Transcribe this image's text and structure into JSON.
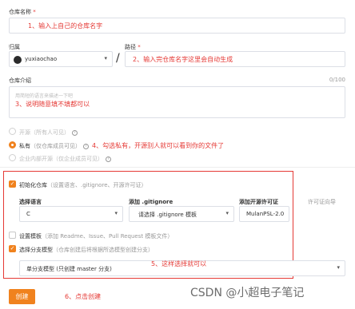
{
  "repo_name": {
    "label": "仓库名称",
    "required_mark": "*",
    "note": "1、输入上自己的仓库名字"
  },
  "owner": {
    "label": "归属",
    "value": "yuxiaochao"
  },
  "path": {
    "label": "路径",
    "required_mark": "*",
    "separator": "/",
    "note": "2、输入完仓库名字这里会自动生成"
  },
  "intro": {
    "label": "仓库介绍",
    "counter": "0/100",
    "placeholder": "用简短的语言来描述一下吧",
    "note": "3、说明随意填不填都可以"
  },
  "visibility": {
    "public": {
      "label": "开源",
      "hint": "（所有人可见）"
    },
    "private": {
      "label": "私有",
      "hint": "（仅仓库成员可见）"
    },
    "enterprise": {
      "label": "企业内部开源",
      "hint": "（仅企业成员可见）"
    },
    "note": "4、勾选私有，开源别人就可以看到你的文件了"
  },
  "init": {
    "label": "初始化仓库",
    "hint": "（设置语言、.gitignore、开源许可证）",
    "language": {
      "label": "选择语言",
      "value": "C"
    },
    "gitignore": {
      "label": "添加 .gitignore",
      "value": "请选择 .gitignore 模板"
    },
    "license": {
      "label": "添加开源许可证",
      "value": "MulanPSL-2.0",
      "extra": "许可证向导"
    }
  },
  "template": {
    "label": "设置模板",
    "hint": "（添加 Readme、Issue、Pull Request 模板文件）"
  },
  "branch": {
    "label": "选择分支模型",
    "hint": "（仓库创建后将根据所选模型创建分支）",
    "value": "单分支模型 (只创建 master 分支)",
    "note": "5、这样选择就可以"
  },
  "create": {
    "label": "创建",
    "note": "6、点击创建"
  },
  "watermark": "CSDN @小超电子笔记",
  "colors": {
    "accent": "#f0821e",
    "annotation": "#e53935"
  }
}
